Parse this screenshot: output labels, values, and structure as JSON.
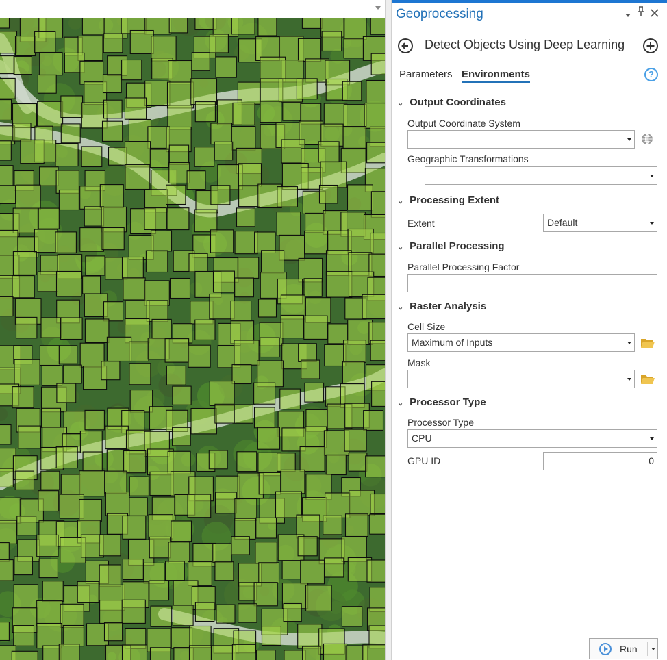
{
  "pane": {
    "title": "Geoprocessing",
    "tool_title": "Detect Objects Using Deep Learning",
    "tabs": [
      {
        "label": "Parameters",
        "active": false
      },
      {
        "label": "Environments",
        "active": true
      }
    ],
    "help_glyph": "?"
  },
  "sections": {
    "output_coordinates": {
      "header": "Output Coordinates",
      "output_coordinate_system": {
        "label": "Output Coordinate System",
        "value": ""
      },
      "geographic_transformations": {
        "label": "Geographic Transformations",
        "value": ""
      }
    },
    "processing_extent": {
      "header": "Processing Extent",
      "extent": {
        "label": "Extent",
        "value": "Default"
      }
    },
    "parallel_processing": {
      "header": "Parallel Processing",
      "factor": {
        "label": "Parallel Processing Factor",
        "value": ""
      }
    },
    "raster_analysis": {
      "header": "Raster Analysis",
      "cell_size": {
        "label": "Cell Size",
        "value": "Maximum of Inputs"
      },
      "mask": {
        "label": "Mask",
        "value": ""
      }
    },
    "processor_type": {
      "header": "Processor Type",
      "processor_type": {
        "label": "Processor Type",
        "value": "CPU"
      },
      "gpu_id": {
        "label": "GPU ID",
        "value": "0"
      }
    }
  },
  "run_button": {
    "label": "Run"
  },
  "icons": {
    "back": "back-arrow-circle-icon",
    "add": "plus-circle-icon",
    "globe": "globe-icon",
    "folder": "folder-icon",
    "run": "play-icon",
    "pin": "pin-icon",
    "close": "close-icon"
  },
  "colors": {
    "accent": "#2372b8",
    "top_bar": "#1d76d2",
    "detection_fill": "#a6d64a",
    "folder": "#e8b93c"
  }
}
